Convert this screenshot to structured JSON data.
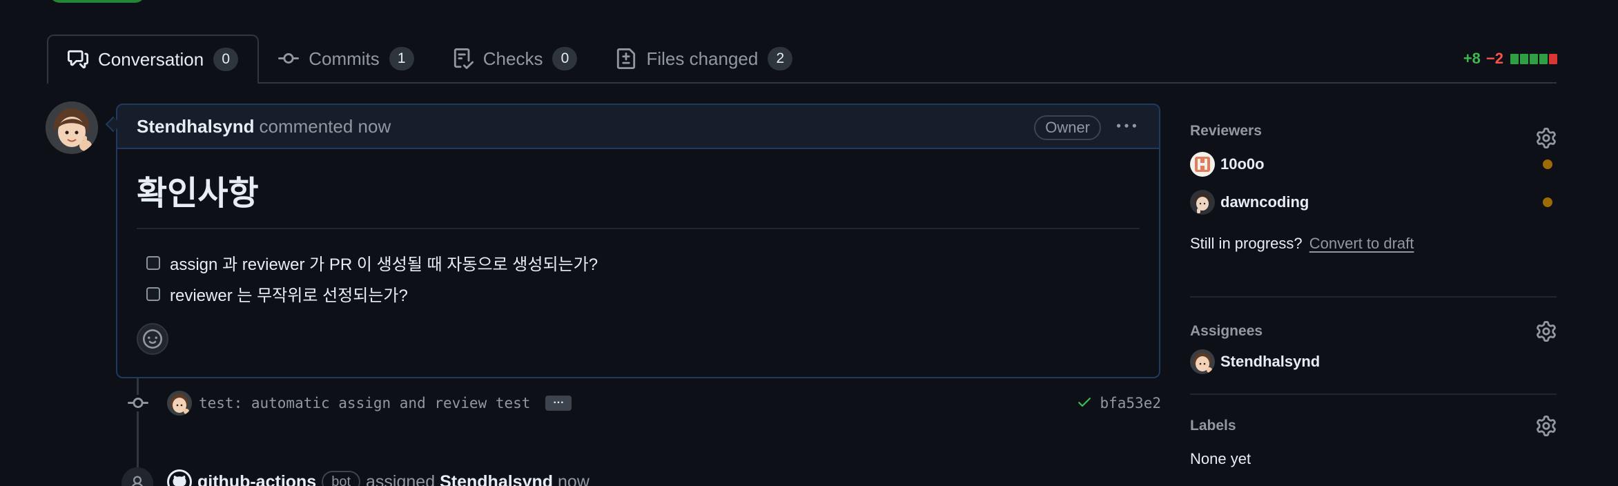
{
  "tabs": [
    {
      "label": "Conversation",
      "count": "0",
      "icon": "comment-discussion-icon"
    },
    {
      "label": "Commits",
      "count": "1",
      "icon": "git-commit-icon"
    },
    {
      "label": "Checks",
      "count": "0",
      "icon": "checklist-icon"
    },
    {
      "label": "Files changed",
      "count": "2",
      "icon": "file-diff-icon"
    }
  ],
  "diffstat": {
    "additions": "+8",
    "deletions": "−2",
    "blocks": [
      "#2ea043",
      "#2ea043",
      "#2ea043",
      "#2ea043",
      "#da3633"
    ]
  },
  "comment": {
    "author": "Stendhalsynd",
    "action": "commented now",
    "badge": "Owner",
    "heading": "확인사항",
    "tasks": [
      "assign 과 reviewer 가 PR 이 생성될 때 자동으로 생성되는가?",
      "reviewer 는 무작위로 선정되는가?"
    ]
  },
  "commit": {
    "message": "test: automatic assign and review test",
    "ellipsis": "···",
    "sha": "bfa53e2",
    "status": "success"
  },
  "assign_event": {
    "actor": "github-actions",
    "badge": "bot",
    "verb": "assigned",
    "target": "Stendhalsynd",
    "time": "now"
  },
  "sidebar": {
    "reviewers": {
      "title": "Reviewers",
      "people": [
        {
          "name": "10o0o",
          "status": "pending"
        },
        {
          "name": "dawncoding",
          "status": "pending"
        }
      ],
      "progress_text": "Still in progress?",
      "draft_link": "Convert to draft"
    },
    "assignees": {
      "title": "Assignees",
      "people": [
        {
          "name": "Stendhalsynd"
        }
      ]
    },
    "labels": {
      "title": "Labels",
      "value": "None yet"
    }
  },
  "colors": {
    "background": "#0d1117",
    "border": "#30363d",
    "comment_border": "#1f3a5f",
    "accent_green": "#3fb950",
    "accent_red": "#f85149",
    "pending": "#9e6a03"
  }
}
